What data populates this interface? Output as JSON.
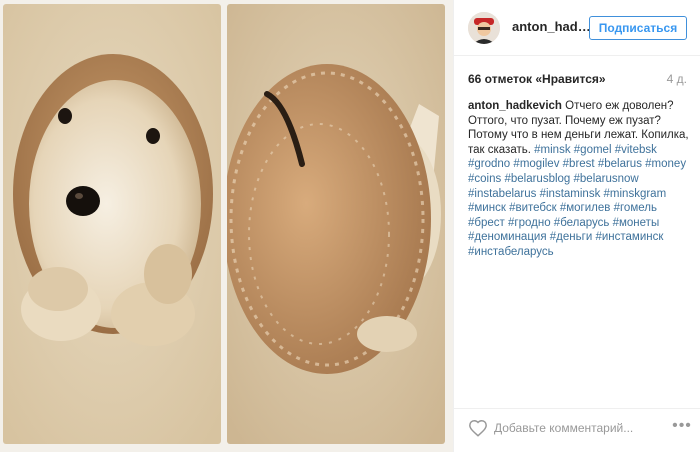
{
  "post": {
    "username": "anton_hadk...",
    "follow_label": "Подписаться",
    "likes_label": "66 отметок «Нравится»",
    "time_ago": "4 д."
  },
  "caption": {
    "author": "anton_hadkevich",
    "text": "Отчего еж доволен? Оттого, что пузат. Почему еж пузат? Потому что в нем деньги лежат. Копилка, так сказать.",
    "hashtags": [
      "#minsk",
      "#gomel",
      "#vitebsk",
      "#grodno",
      "#mogilev",
      "#brest",
      "#belarus",
      "#money",
      "#coins",
      "#belarusblog",
      "#belarusnow",
      "#instabelarus",
      "#instaminsk",
      "#minskgram",
      "#минск",
      "#витебск",
      "#могилев",
      "#гомель",
      "#брест",
      "#гродно",
      "#беларусь",
      "#монеты",
      "#деноминация",
      "#деньги",
      "#инстаминск",
      "#инстабеларусь"
    ]
  },
  "comment": {
    "placeholder": "Добавьте комментарий..."
  },
  "icons": {
    "like": "heart-icon",
    "more": "more-options-icon",
    "avatar": "avatar"
  },
  "colors": {
    "follow": "#3897f0",
    "hashtag": "#3f729b",
    "text": "#262626",
    "muted": "#999999"
  }
}
